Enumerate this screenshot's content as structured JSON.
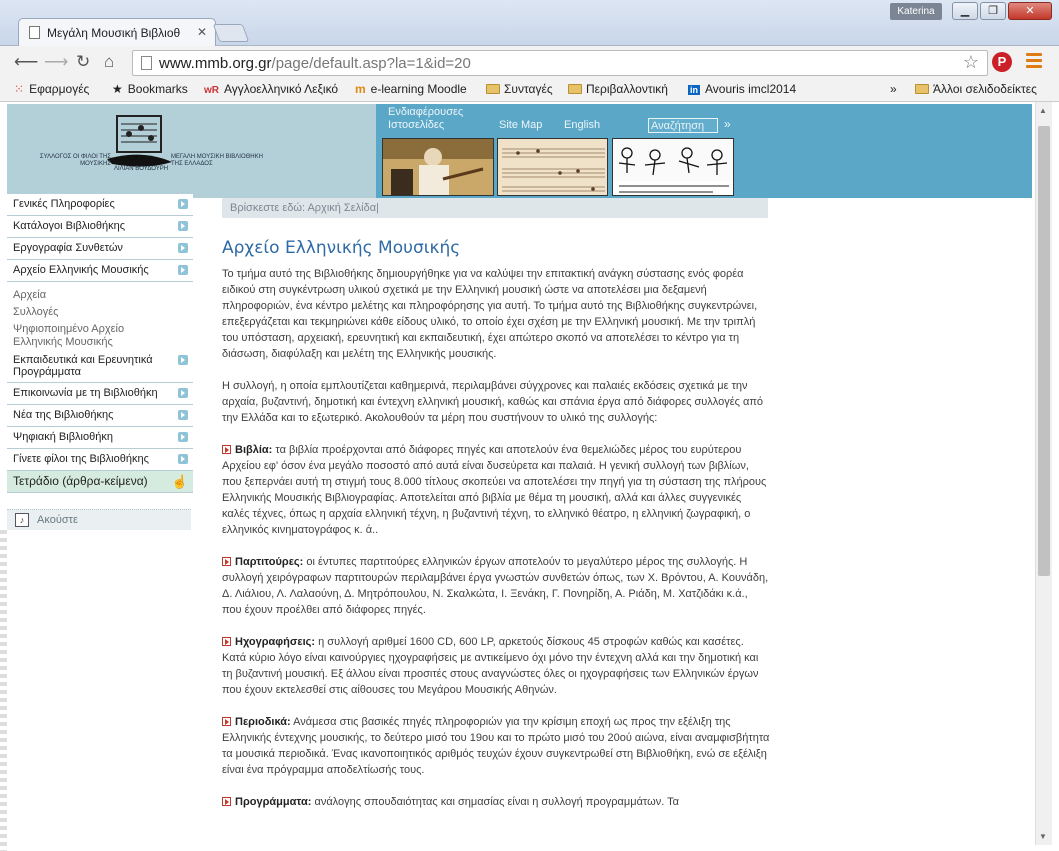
{
  "browser": {
    "title_hint": "",
    "tab_title": "Μεγάλη Μουσική Βιβλιοθ",
    "user": "Katerina",
    "url_domain": "www.mmb.org.gr",
    "url_path": "/page/default.asp?la=1&id=20",
    "bookmarks": [
      {
        "label": "Εφαρμογές",
        "icon": "apps-grid-icon"
      },
      {
        "label": "Bookmarks",
        "icon": "star-icon"
      },
      {
        "label": "Αγγλοελληνικό Λεξικό",
        "icon": "wordreference-icon"
      },
      {
        "label": "e-learning Moodle",
        "icon": "moodle-icon"
      },
      {
        "label": "Συνταγές",
        "icon": "folder-icon"
      },
      {
        "label": "Περιβαλλοντική",
        "icon": "folder-icon"
      },
      {
        "label": "Avouris imcl2014",
        "icon": "linkedin-icon"
      },
      {
        "label": "Άλλοι σελιδοδείκτες",
        "icon": "folder-icon"
      }
    ],
    "more_label": "»"
  },
  "header": {
    "logo_left": "ΣΥΛΛΟΓΟΣ ΟΙ ΦΙΛΟΙ ΤΗΣ ΜΟΥΣΙΚΗΣ",
    "logo_right": "ΜΕΓΑΛΗ ΜΟΥΣΙΚΗ ΒΙΒΛΙΟΘΗΚΗ ΤΗΣ ΕΛΛΑΔΟΣ",
    "logo_bottom": "ΛΙΛΙΑΝ ΒΟΥΔΟΥΡΗ",
    "nav": {
      "links_1": "Ενδιαφέρουσες",
      "links_2": "Ιστοσελίδες",
      "sitemap": "Site Map",
      "english": "English",
      "search_value": "Αναζήτηση",
      "search_go": "»"
    }
  },
  "breadcrumb": "Βρίσκεστε εδώ: Αρχική Σελίδα|",
  "sidebar": {
    "items": [
      "Γενικές Πληροφορίες",
      "Κατάλογοι Βιβλιοθήκης",
      "Εργογραφία Συνθετών",
      "Αρχείο Ελληνικής Μουσικής"
    ],
    "subitems": [
      "Αρχεία",
      "Συλλογές",
      "Ψηφιοποιημένο Αρχείο Ελληνικής Μουσικής"
    ],
    "items2": [
      "Εκπαιδευτικά και Ερευνητικά Προγράμματα",
      "Επικοινωνία με τη Βιβλιοθήκη",
      "Νέα της Βιβλιοθήκης",
      "Ψηφιακή Βιβλιοθήκη",
      "Γίνετε φίλοι της Βιβλιοθήκης",
      "Τετράδιο (άρθρα-κείμενα)"
    ],
    "listen": "Ακούστε"
  },
  "content": {
    "title": "Αρχείο Ελληνικής Μουσικής",
    "intro": "Το τμήμα αυτό της Βιβλιοθήκης δημιουργήθηκε για να καλύψει την επιτακτική ανάγκη σύστασης ενός φορέα ειδικού στη συγκέντρωση υλικού σχετικά με την Ελληνική μουσική ώστε να αποτελέσει μια δεξαμενή πληροφοριών, ένα κέντρο μελέτης και πληροφόρησης για αυτή. Το τμήμα αυτό της Βιβλιοθήκης συγκεντρώνει, επεξεργάζεται και τεκμηριώνει κάθε είδους υλικό, το οποίο έχει σχέση με την Ελληνική μουσική. Με την τριπλή του υπόσταση, αρχειακή, ερευνητική και εκπαιδευτική, έχει απώτερο σκοπό να αποτελέσει το κέντρο για τη διάσωση, διαφύλαξη και μελέτη της Ελληνικής μουσικής.",
    "collection": "Η συλλογή, η οποία εμπλουτίζεται καθημερινά, περιλαμβάνει σύγχρονες και παλαιές εκδόσεις σχετικά με την αρχαία, βυζαντινή, δημοτική και έντεχνη ελληνική μουσική, καθώς και σπάνια έργα από διάφορες συλλογές από την Ελλάδα και το εξωτερικό. Ακολουθούν τα μέρη που συστήνουν το υλικό της συλλογής:",
    "sections": [
      {
        "head": "Βιβλία:",
        "text": " τα βιβλία προέρχονται από διάφορες πηγές και αποτελούν ένα θεμελιώδες μέρος του ευρύτερου Αρχείου  εφ' όσον ένα μεγάλο ποσοστό από αυτά είναι δυσεύρετα και παλαιά. Η γενική συλλογή των βιβλίων, που ξεπερνάει αυτή τη στιγμή τους 8.000 τίτλους σκοπεύει να αποτελέσει την πηγή για τη σύσταση της πλήρους Ελληνικής Μουσικής Βιβλιογραφίας. Αποτελείται από βιβλία με θέμα τη μουσική, αλλά και άλλες συγγενικές καλές τέχνες, όπως η αρχαία ελληνική τέχνη, η βυζαντινή τέχνη, το ελληνικό θέατρο, η ελληνική ζωγραφική, ο ελληνικός κινηματογράφος κ. ά.."
      },
      {
        "head": "Παρτιτούρες:",
        "text": " οι έντυπες παρτιτούρες ελληνικών έργων αποτελούν το μεγαλύτερο μέρος της συλλογής. Η συλλογή χειρόγραφων παρτιτουρών περιλαμβάνει έργα γνωστών συνθετών όπως, των Χ. Βρόντου, Α. Κουνάδη, Δ. Λιάλιου, Λ. Λαλαούνη, Δ. Μητρόπουλου, Ν. Σκαλκώτα, Ι. Ξενάκη, Γ. Πονηρίδη, Α. Ριάδη, Μ. Χατζιδάκι κ.ά., που έχουν προέλθει από διάφορες πηγές."
      },
      {
        "head": "Ηχογραφήσεις:",
        "text": " η συλλογή αριθμεί 1600 CD, 600 LP, αρκετούς δίσκους 45 στροφών καθώς και κασέτες. Κατά κύριο λόγο είναι καινούργιες ηχογραφήσεις με αντικείμενο όχι μόνο την έντεχνη αλλά και την δημοτική και τη βυζαντινή μουσική. Εξ άλλου είναι προσιτές στους αναγνώστες όλες οι ηχογραφήσεις των Ελληνικών έργων που έχουν εκτελεσθεί στις αίθουσες του Μεγάρου Μουσικής Αθηνών."
      },
      {
        "head": "Περιοδικά:",
        "text": " Ανάμεσα στις βασικές πηγές πληροφοριών για την κρίσιμη εποχή ως προς την εξέλιξη της Ελληνικής έντεχνης μουσικής, το δεύτερο μισό του 19ου και το πρώτο μισό του 20ού αιώνα, είναι αναμφισβήτητα τα μουσικά περιοδικά. Ένας ικανοποιητικός αριθμός τευχών έχουν συγκεντρωθεί στη Βιβλιοθήκη, ενώ σε εξέλιξη είναι ένα πρόγραμμα αποδελτίωσής τους."
      },
      {
        "head": "Προγράμματα:",
        "text": " ανάλογης σπουδαιότητας και σημασίας είναι η συλλογή προγραμμάτων. Τα"
      }
    ]
  },
  "colors": {
    "header": "#5aa7c8",
    "title": "#2f6aa5",
    "sidebar_border": "#b7cdd6"
  }
}
